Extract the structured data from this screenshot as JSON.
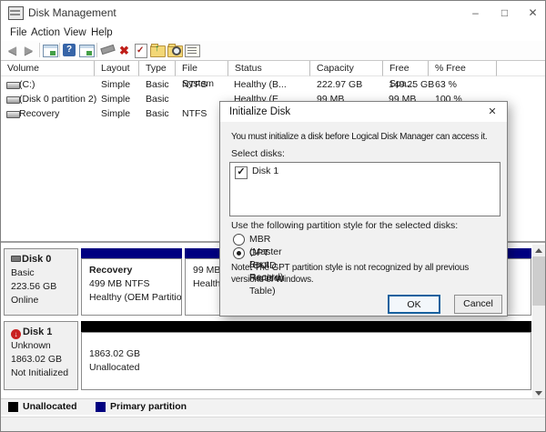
{
  "window": {
    "title": "Disk Management"
  },
  "menu": {
    "items": [
      "File",
      "Action",
      "View",
      "Help"
    ]
  },
  "toolbar": {
    "icons": [
      "back-icon",
      "forward-icon",
      "console-window-icon",
      "help-icon",
      "console-window-export-icon",
      "tool-icon",
      "delete-volume-icon",
      "check-document-icon",
      "folder-up-icon",
      "folder-search-icon",
      "properties-icon"
    ]
  },
  "volume_list": {
    "columns": [
      "Volume",
      "Layout",
      "Type",
      "File System",
      "Status",
      "Capacity",
      "Free Spa...",
      "% Free"
    ],
    "rows": [
      {
        "volume": "(C:)",
        "layout": "Simple",
        "type": "Basic",
        "fs": "NTFS",
        "status": "Healthy (B...",
        "capacity": "222.97 GB",
        "free": "140.25 GB",
        "pct": "63 %"
      },
      {
        "volume": "(Disk 0 partition 2)",
        "layout": "Simple",
        "type": "Basic",
        "fs": "",
        "status": "Healthy (E",
        "capacity": "99 MB",
        "free": "99 MB",
        "pct": "100 %"
      },
      {
        "volume": "Recovery",
        "layout": "Simple",
        "type": "Basic",
        "fs": "NTFS",
        "status": "",
        "capacity": "",
        "free": "",
        "pct": ""
      }
    ]
  },
  "disks": [
    {
      "name": "Disk 0",
      "type": "Basic",
      "size": "223.56 GB",
      "status": "Online",
      "partitions": [
        {
          "name": "Recovery",
          "size": "499 MB NTFS",
          "status": "Healthy (OEM Partition)",
          "bar_color": "#000080"
        },
        {
          "name": "",
          "size": "99 MB",
          "status": "Healthy",
          "bar_color": "#000080"
        }
      ]
    },
    {
      "name": "Disk 1",
      "type": "Unknown",
      "size": "1863.02 GB",
      "status": "Not Initialized",
      "partitions": [
        {
          "name": "",
          "size": "1863.02 GB",
          "status": "Unallocated",
          "bar_color": "#000000"
        }
      ]
    }
  ],
  "legend": {
    "items": [
      {
        "label": "Unallocated",
        "color": "#000000"
      },
      {
        "label": "Primary partition",
        "color": "#000080"
      }
    ]
  },
  "dialog": {
    "title": "Initialize Disk",
    "message": "You must initialize a disk before Logical Disk Manager can access it.",
    "select_label": "Select disks:",
    "disks": [
      {
        "label": "Disk 1",
        "checked": true
      }
    ],
    "style_label": "Use the following partition style for the selected disks:",
    "options": [
      {
        "label": "MBR (Master Boot Record)",
        "selected": false
      },
      {
        "label": "GPT (GUID Partition Table)",
        "selected": true
      }
    ],
    "note": "Note: The GPT partition style is not recognized by all previous versions of Windows.",
    "buttons": {
      "ok": "OK",
      "cancel": "Cancel"
    }
  },
  "colors": {
    "primary_partition": "#000080",
    "unallocated": "#000000",
    "accent": "#16619e",
    "delete_red": "#bf1d17"
  }
}
